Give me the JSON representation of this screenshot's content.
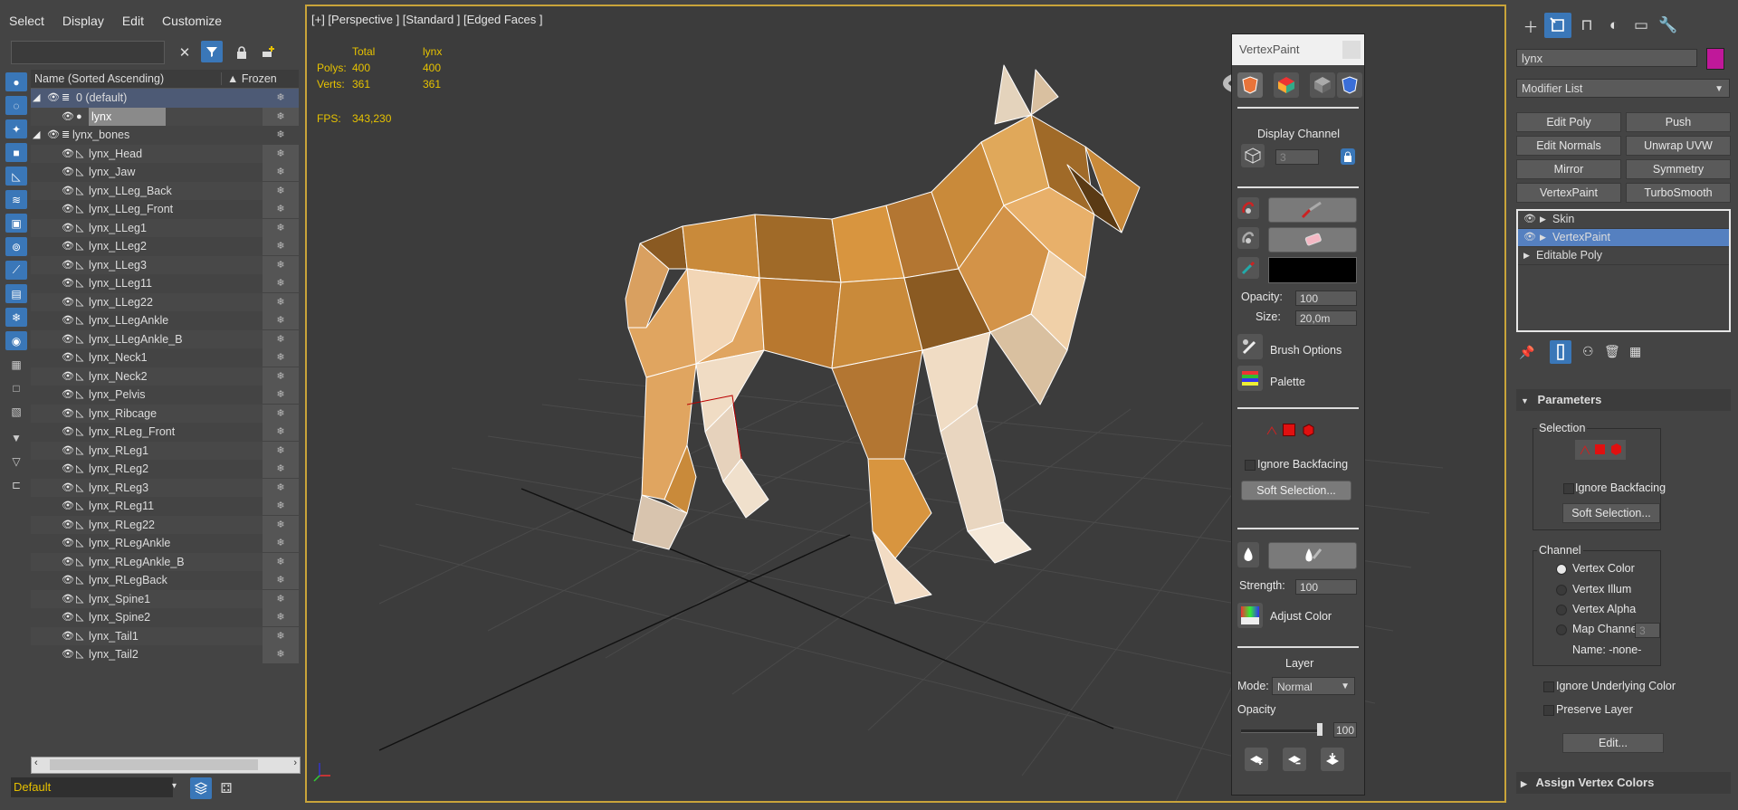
{
  "menu": [
    "Select",
    "Display",
    "Edit",
    "Customize"
  ],
  "explorer": {
    "columns": {
      "name": "Name (Sorted Ascending)",
      "frozen": "▲ Frozen"
    },
    "rows": [
      {
        "name": "0 (default)",
        "level": 0,
        "type": "layer",
        "selected": true
      },
      {
        "name": "lynx",
        "level": 1,
        "type": "mesh",
        "selected": true
      },
      {
        "name": "lynx_bones",
        "level": 0,
        "type": "layer"
      },
      {
        "name": "lynx_Head",
        "level": 1,
        "type": "bone"
      },
      {
        "name": "lynx_Jaw",
        "level": 1,
        "type": "bone"
      },
      {
        "name": "lynx_LLeg_Back",
        "level": 1,
        "type": "bone"
      },
      {
        "name": "lynx_LLeg_Front",
        "level": 1,
        "type": "bone"
      },
      {
        "name": "lynx_LLeg1",
        "level": 1,
        "type": "bone"
      },
      {
        "name": "lynx_LLeg2",
        "level": 1,
        "type": "bone"
      },
      {
        "name": "lynx_LLeg3",
        "level": 1,
        "type": "bone"
      },
      {
        "name": "lynx_LLeg11",
        "level": 1,
        "type": "bone"
      },
      {
        "name": "lynx_LLeg22",
        "level": 1,
        "type": "bone"
      },
      {
        "name": "lynx_LLegAnkle",
        "level": 1,
        "type": "bone"
      },
      {
        "name": "lynx_LLegAnkle_B",
        "level": 1,
        "type": "bone"
      },
      {
        "name": "lynx_Neck1",
        "level": 1,
        "type": "bone"
      },
      {
        "name": "lynx_Neck2",
        "level": 1,
        "type": "bone"
      },
      {
        "name": "lynx_Pelvis",
        "level": 1,
        "type": "bone"
      },
      {
        "name": "lynx_Ribcage",
        "level": 1,
        "type": "bone"
      },
      {
        "name": "lynx_RLeg_Front",
        "level": 1,
        "type": "bone"
      },
      {
        "name": "lynx_RLeg1",
        "level": 1,
        "type": "bone"
      },
      {
        "name": "lynx_RLeg2",
        "level": 1,
        "type": "bone"
      },
      {
        "name": "lynx_RLeg3",
        "level": 1,
        "type": "bone"
      },
      {
        "name": "lynx_RLeg11",
        "level": 1,
        "type": "bone"
      },
      {
        "name": "lynx_RLeg22",
        "level": 1,
        "type": "bone"
      },
      {
        "name": "lynx_RLegAnkle",
        "level": 1,
        "type": "bone"
      },
      {
        "name": "lynx_RLegAnkle_B",
        "level": 1,
        "type": "bone"
      },
      {
        "name": "lynx_RLegBack",
        "level": 1,
        "type": "bone"
      },
      {
        "name": "lynx_Spine1",
        "level": 1,
        "type": "bone"
      },
      {
        "name": "lynx_Spine2",
        "level": 1,
        "type": "bone"
      },
      {
        "name": "lynx_Tail1",
        "level": 1,
        "type": "bone"
      },
      {
        "name": "lynx_Tail2",
        "level": 1,
        "type": "bone"
      }
    ],
    "layer_value": "Default"
  },
  "viewport": {
    "label": "[+] [Perspective ] [Standard ] [Edged Faces ]",
    "stats": {
      "total_header": "Total",
      "obj_header": "lynx",
      "polys_label": "Polys:",
      "polys_total": "400",
      "polys_obj": "400",
      "verts_label": "Verts:",
      "verts_total": "361",
      "verts_obj": "361",
      "fps_label": "FPS:",
      "fps_value": "343,230"
    },
    "accent": "#c9a43a"
  },
  "vertex_paint": {
    "title": "VertexPaint",
    "display_channel": "Display Channel",
    "channel_value": "3",
    "opacity_label": "Opacity:",
    "opacity_value": "100",
    "size_label": "Size:",
    "size_value": "20,0m",
    "brush_options": "Brush Options",
    "palette": "Palette",
    "ignore_backfacing": "Ignore Backfacing",
    "soft_selection": "Soft Selection...",
    "strength_label": "Strength:",
    "strength_value": "100",
    "adjust_color": "Adjust Color",
    "layer_title": "Layer",
    "mode_label": "Mode:",
    "mode_value": "Normal",
    "layer_opacity_label": "Opacity",
    "layer_opacity_value": "100",
    "layer_opacity_level": 1.0
  },
  "command_panel": {
    "object_name": "lynx",
    "object_color": "#c0189a",
    "modifier_list": "Modifier List",
    "modifier_buttons": [
      "Edit Poly",
      "Push",
      "Edit Normals",
      "Unwrap UVW",
      "Mirror",
      "Symmetry",
      "VertexPaint",
      "TurboSmooth"
    ],
    "stack": [
      {
        "name": "Skin",
        "selected": false
      },
      {
        "name": "VertexPaint",
        "selected": true
      },
      {
        "name": "Editable Poly",
        "selected": false
      }
    ],
    "parameters": "Parameters",
    "selection_group": "Selection",
    "ignore_backfacing": "Ignore Backfacing",
    "soft_selection": "Soft Selection...",
    "channel_group": "Channel",
    "channels": [
      "Vertex Color",
      "Vertex Illum",
      "Vertex Alpha",
      "Map Channel"
    ],
    "map_channel_value": "3",
    "name_label": "Name: -none-",
    "ignore_underlying": "Ignore Underlying Color",
    "preserve_layer": "Preserve Layer",
    "edit_button": "Edit...",
    "assign_vertex_colors": "Assign Vertex Colors"
  }
}
